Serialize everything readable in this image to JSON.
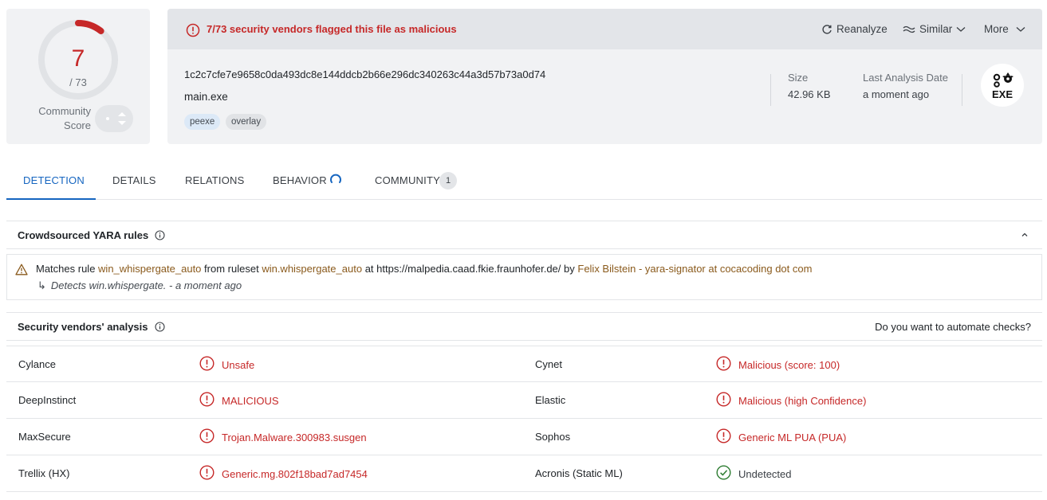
{
  "score": {
    "detections": "7",
    "total": "/ 73",
    "community_label": "Community\nScore"
  },
  "alert": {
    "text": "7/73 security vendors flagged this file as malicious"
  },
  "actions": {
    "reanalyze": "Reanalyze",
    "similar": "Similar",
    "more": "More"
  },
  "file": {
    "hash": "1c2c7cfe7e9658c0da493dc8e144ddcb2b66e296dc340263c44a3d57b73a0d74",
    "name": "main.exe",
    "tags": [
      "peexe",
      "overlay"
    ],
    "size_label": "Size",
    "size": "42.96 KB",
    "date_label": "Last Analysis Date",
    "date": "a moment ago",
    "type_badge": "EXE"
  },
  "tabs": [
    {
      "label": "DETECTION",
      "active": true
    },
    {
      "label": "DETAILS"
    },
    {
      "label": "RELATIONS"
    },
    {
      "label": "BEHAVIOR"
    },
    {
      "label": "COMMUNITY",
      "count": "1"
    }
  ],
  "yara": {
    "title": "Crowdsourced YARA rules",
    "prefix": "Matches rule",
    "rule": "win_whispergate_auto",
    "mid": "from ruleset",
    "ruleset": "win.whispergate_auto",
    "at": "at https://malpedia.caad.fkie.fraunhofer.de/ by",
    "author": "Felix Bilstein - yara-signator at cocacoding dot com",
    "detects": "Detects win.whispergate. - a moment ago"
  },
  "vendors": {
    "title": "Security vendors' analysis",
    "automate": "Do you want to automate checks?",
    "rows": [
      {
        "left": {
          "name": "Cylance",
          "result": "Unsafe"
        },
        "right": {
          "name": "Cynet",
          "result": "Malicious (score: 100)"
        }
      },
      {
        "left": {
          "name": "DeepInstinct",
          "result": "MALICIOUS"
        },
        "right": {
          "name": "Elastic",
          "result": "Malicious (high Confidence)"
        }
      },
      {
        "left": {
          "name": "MaxSecure",
          "result": "Trojan.Malware.300983.susgen"
        },
        "right": {
          "name": "Sophos",
          "result": "Generic ML PUA (PUA)"
        }
      },
      {
        "left": {
          "name": "Trellix (HX)",
          "result": "Generic.mg.802f18bad7ad7454"
        },
        "right": {
          "name": "Acronis (Static ML)",
          "result": "Undetected"
        }
      }
    ]
  },
  "colors": {
    "malicious": "#c62828",
    "accent": "#1565c0",
    "ok": "#2e7d32"
  }
}
